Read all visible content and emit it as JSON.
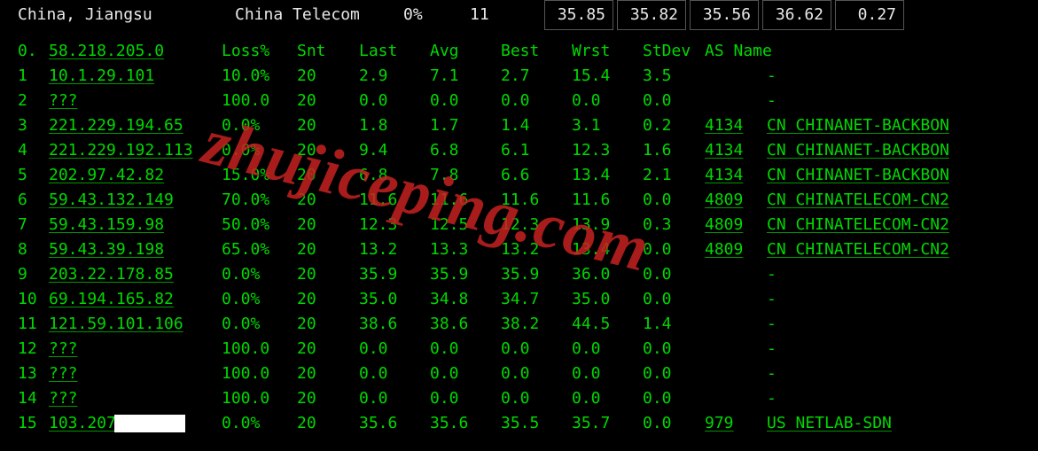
{
  "top": {
    "location": "China, Jiangsu",
    "isp": "China Telecom",
    "pct": "0%",
    "count": "11",
    "boxes": [
      "35.85",
      "35.82",
      "35.56",
      "36.62",
      "0.27"
    ]
  },
  "headers": {
    "hop": "0.",
    "host": "58.218.205.0",
    "loss": "Loss%",
    "snt": "Snt",
    "last": "Last",
    "avg": "Avg",
    "best": "Best",
    "wrst": "Wrst",
    "stdev": "StDev",
    "asname_label": "AS Name"
  },
  "rows": [
    {
      "n": "1",
      "host": "10.1.29.101",
      "loss": "10.0%",
      "snt": "20",
      "last": "2.9",
      "avg": "7.1",
      "best": "2.7",
      "wrst": "15.4",
      "stdev": "3.5",
      "asn": "",
      "asname": "-"
    },
    {
      "n": "2",
      "host": "???",
      "loss": "100.0",
      "snt": "20",
      "last": "0.0",
      "avg": "0.0",
      "best": "0.0",
      "wrst": "0.0",
      "stdev": "0.0",
      "asn": "",
      "asname": "-"
    },
    {
      "n": "3",
      "host": "221.229.194.65",
      "loss": "0.0%",
      "snt": "20",
      "last": "1.8",
      "avg": "1.7",
      "best": "1.4",
      "wrst": "3.1",
      "stdev": "0.2",
      "asn": "4134",
      "asname": "CN CHINANET-BACKBON"
    },
    {
      "n": "4",
      "host": "221.229.192.113",
      "loss": "0.0%",
      "snt": "20",
      "last": "9.4",
      "avg": "6.8",
      "best": "6.1",
      "wrst": "12.3",
      "stdev": "1.6",
      "asn": "4134",
      "asname": "CN CHINANET-BACKBON"
    },
    {
      "n": "5",
      "host": "202.97.42.82",
      "loss": "15.0%",
      "snt": "20",
      "last": "6.8",
      "avg": "7.8",
      "best": "6.6",
      "wrst": "13.4",
      "stdev": "2.1",
      "asn": "4134",
      "asname": "CN CHINANET-BACKBON"
    },
    {
      "n": "6",
      "host": "59.43.132.149",
      "loss": "70.0%",
      "snt": "20",
      "last": "11.6",
      "avg": "11.6",
      "best": "11.6",
      "wrst": "11.6",
      "stdev": "0.0",
      "asn": "4809",
      "asname": "CN CHINATELECOM-CN2"
    },
    {
      "n": "7",
      "host": "59.43.159.98",
      "loss": "50.0%",
      "snt": "20",
      "last": "12.3",
      "avg": "12.5",
      "best": "12.3",
      "wrst": "13.9",
      "stdev": "0.3",
      "asn": "4809",
      "asname": "CN CHINATELECOM-CN2"
    },
    {
      "n": "8",
      "host": "59.43.39.198",
      "loss": "65.0%",
      "snt": "20",
      "last": "13.2",
      "avg": "13.3",
      "best": "13.2",
      "wrst": "13.4",
      "stdev": "0.0",
      "asn": "4809",
      "asname": "CN CHINATELECOM-CN2"
    },
    {
      "n": "9",
      "host": "203.22.178.85",
      "loss": "0.0%",
      "snt": "20",
      "last": "35.9",
      "avg": "35.9",
      "best": "35.9",
      "wrst": "36.0",
      "stdev": "0.0",
      "asn": "",
      "asname": "-"
    },
    {
      "n": "10",
      "host": "69.194.165.82",
      "loss": "0.0%",
      "snt": "20",
      "last": "35.0",
      "avg": "34.8",
      "best": "34.7",
      "wrst": "35.0",
      "stdev": "0.0",
      "asn": "",
      "asname": "-"
    },
    {
      "n": "11",
      "host": "121.59.101.106",
      "loss": "0.0%",
      "snt": "20",
      "last": "38.6",
      "avg": "38.6",
      "best": "38.2",
      "wrst": "44.5",
      "stdev": "1.4",
      "asn": "",
      "asname": "-"
    },
    {
      "n": "12",
      "host": "???",
      "loss": "100.0",
      "snt": "20",
      "last": "0.0",
      "avg": "0.0",
      "best": "0.0",
      "wrst": "0.0",
      "stdev": "0.0",
      "asn": "",
      "asname": "-"
    },
    {
      "n": "13",
      "host": "???",
      "loss": "100.0",
      "snt": "20",
      "last": "0.0",
      "avg": "0.0",
      "best": "0.0",
      "wrst": "0.0",
      "stdev": "0.0",
      "asn": "",
      "asname": "-"
    },
    {
      "n": "14",
      "host": "???",
      "loss": "100.0",
      "snt": "20",
      "last": "0.0",
      "avg": "0.0",
      "best": "0.0",
      "wrst": "0.0",
      "stdev": "0.0",
      "asn": "",
      "asname": "-"
    },
    {
      "n": "15",
      "host": "103.207",
      "host_redacted": true,
      "loss": "0.0%",
      "snt": "20",
      "last": "35.6",
      "avg": "35.6",
      "best": "35.5",
      "wrst": "35.7",
      "stdev": "0.0",
      "asn": "979",
      "asname": "US NETLAB-SDN"
    }
  ],
  "watermark": "zhujiceping.com"
}
